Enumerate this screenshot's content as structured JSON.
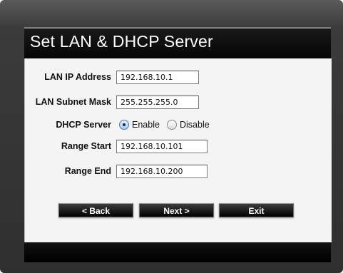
{
  "window": {
    "title": "Set LAN & DHCP Server"
  },
  "form": {
    "lan_ip": {
      "label": "LAN IP Address",
      "value": "192.168.10.1"
    },
    "subnet": {
      "label": "LAN Subnet Mask",
      "value": "255.255.255.0"
    },
    "dhcp": {
      "label": "DHCP Server",
      "enable_label": "Enable",
      "disable_label": "Disable",
      "selected": "Enable"
    },
    "range_start": {
      "label": "Range Start",
      "value": "192.168.10.101"
    },
    "range_end": {
      "label": "Range End",
      "value": "192.168.10.200"
    }
  },
  "buttons": {
    "back": "< Back",
    "next": "Next >",
    "exit": "Exit"
  },
  "colors": {
    "frame": "#2f2f2f",
    "header": "#050505",
    "panel": "#f4f4f4",
    "radio_selected": "#4a78b8"
  }
}
